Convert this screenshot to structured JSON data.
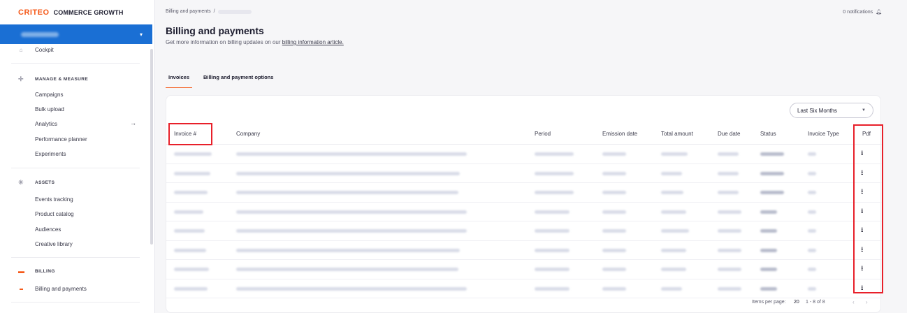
{
  "brand": {
    "logo": "CRITEO",
    "product": "COMMERCE GROWTH"
  },
  "sidebar": {
    "cockpit": "Cockpit",
    "manage_section": "MANAGE & MEASURE",
    "manage_items": [
      "Campaigns",
      "Bulk upload",
      "Analytics",
      "Performance planner",
      "Experiments"
    ],
    "assets_section": "ASSETS",
    "assets_items": [
      "Events tracking",
      "Product catalog",
      "Audiences",
      "Creative library"
    ],
    "billing_section": "BILLING",
    "billing_items": [
      "Billing and payments"
    ]
  },
  "header": {
    "breadcrumb": "Billing and payments",
    "notifications": "0 notifications",
    "title": "Billing and payments",
    "subtitle_prefix": "Get more information on billing updates on our",
    "subtitle_link": "billing information article."
  },
  "tabs": [
    "Invoices",
    "Billing and payment options"
  ],
  "filter": {
    "period": "Last Six Months"
  },
  "table": {
    "columns": [
      "Invoice #",
      "Company",
      "Period",
      "Emission date",
      "Total amount",
      "Due date",
      "Status",
      "Invoice Type",
      "Pdf"
    ],
    "row_count": 8
  },
  "pagination": {
    "items_per_page_label": "Items per page:",
    "items_per_page": "20",
    "range": "1 - 8 of 8"
  },
  "colors": {
    "accent": "#f55a1a",
    "primary": "#1a6fd4",
    "highlight": "#e8202a"
  },
  "icons": {
    "download": "download-icon",
    "bell": "bell-icon",
    "chevron": "chevron-down-icon"
  }
}
